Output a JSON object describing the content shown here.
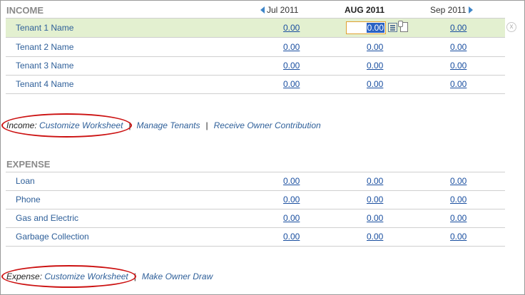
{
  "income": {
    "title": "INCOME",
    "months": {
      "prev": "Jul 2011",
      "current": "AUG 2011",
      "next": "Sep 2011"
    },
    "rows": [
      {
        "label": "Tenant 1 Name",
        "jul": "0.00",
        "aug": "0.00",
        "sep": "0.00"
      },
      {
        "label": "Tenant 2 Name",
        "jul": "0.00",
        "aug": "0.00",
        "sep": "0.00"
      },
      {
        "label": "Tenant 3 Name",
        "jul": "0.00",
        "aug": "0.00",
        "sep": "0.00"
      },
      {
        "label": "Tenant 4 Name",
        "jul": "0.00",
        "aug": "0.00",
        "sep": "0.00"
      }
    ],
    "links": {
      "prefix": "Income:",
      "customize": "Customize Worksheet",
      "manage_tenants": "Manage Tenants",
      "receive_contribution": "Receive Owner Contribution"
    }
  },
  "expense": {
    "title": "EXPENSE",
    "rows": [
      {
        "label": "Loan",
        "jul": "0.00",
        "aug": "0.00",
        "sep": "0.00"
      },
      {
        "label": "Phone",
        "jul": "0.00",
        "aug": "0.00",
        "sep": "0.00"
      },
      {
        "label": "Gas and Electric",
        "jul": "0.00",
        "aug": "0.00",
        "sep": "0.00"
      },
      {
        "label": "Garbage Collection",
        "jul": "0.00",
        "aug": "0.00",
        "sep": "0.00"
      }
    ],
    "links": {
      "prefix": "Expense:",
      "customize": "Customize Worksheet",
      "owner_draw": "Make Owner Draw"
    }
  },
  "separator": "|",
  "close_glyph": "x",
  "annotation_color": "#cc1111",
  "highlight_color": "#e3f0d0"
}
